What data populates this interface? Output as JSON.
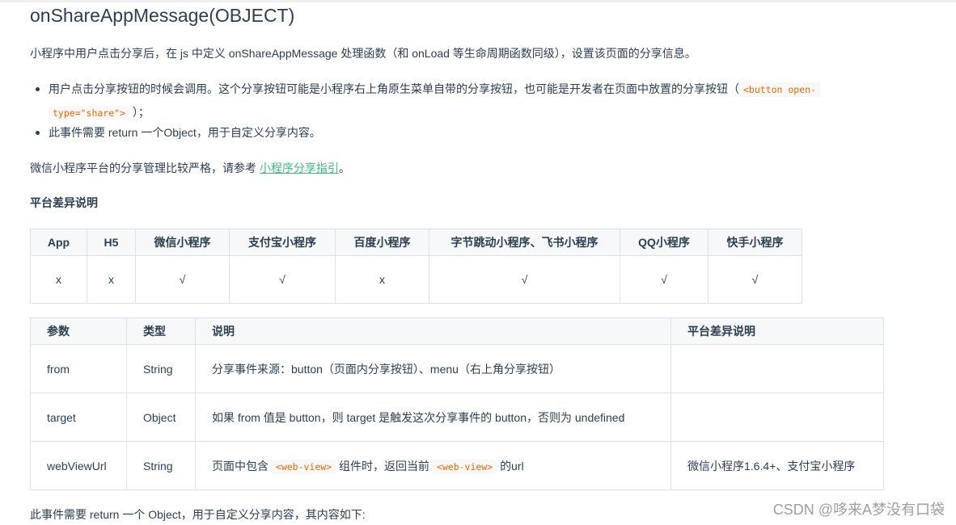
{
  "title": "onShareAppMessage(OBJECT)",
  "intro": "小程序中用户点击分享后，在 js 中定义 onShareAppMessage 处理函数（和 onLoad 等生命周期函数同级），设置该页面的分享信息。",
  "bullets": [
    {
      "text_before": "用户点击分享按钮的时候会调用。这个分享按钮可能是小程序右上角原生菜单自带的分享按钮，也可能是开发者在页面中放置的分享按钮（",
      "code_line1": "<button open-",
      "code_line2": "type=\"share\">",
      "text_after": "）；"
    },
    {
      "text": "此事件需要 return 一个Object，用于自定义分享内容。"
    }
  ],
  "guide_para": {
    "text_before": "微信小程序平台的分享管理比较严格，请参考",
    "link": "小程序分享指引",
    "text_after": "。"
  },
  "platform_heading": "平台差异说明",
  "platform_table": {
    "headers": [
      "App",
      "H5",
      "微信小程序",
      "支付宝小程序",
      "百度小程序",
      "字节跳动小程序、飞书小程序",
      "QQ小程序",
      "快手小程序"
    ],
    "values": [
      "x",
      "x",
      "√",
      "√",
      "x",
      "√",
      "√",
      "√"
    ]
  },
  "param_table": {
    "headers": [
      "参数",
      "类型",
      "说明",
      "平台差异说明"
    ],
    "rows": [
      {
        "param": "from",
        "type": "String",
        "desc": "分享事件来源：button（页面内分享按钮）、menu（右上角分享按钮）",
        "platform": ""
      },
      {
        "param": "target",
        "type": "Object",
        "desc": "如果 from 值是 button，则 target 是触发这次分享事件的 button，否则为 undefined",
        "platform": ""
      },
      {
        "param": "webViewUrl",
        "type": "String",
        "desc_before": "页面中包含",
        "desc_code1": "<web-view>",
        "desc_middle": "组件时，返回当前",
        "desc_code2": "<web-view>",
        "desc_after": "的url",
        "platform": "微信小程序1.6.4+、支付宝小程序"
      }
    ]
  },
  "bottom_text": "此事件需要 return 一个 Object，用于自定义分享内容，其内容如下:",
  "watermark": "CSDN @哆来A梦没有口袋"
}
